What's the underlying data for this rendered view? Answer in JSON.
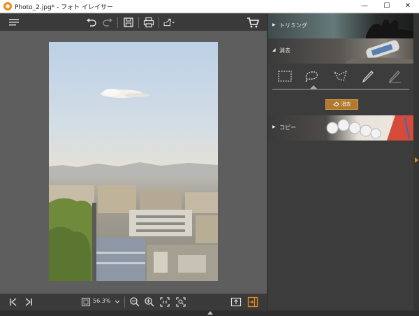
{
  "window": {
    "title": "Photo_2.jpg* - フォト イレイサー",
    "minimize_glyph": "—",
    "maximize_glyph": "☐",
    "close_glyph": "✕",
    "app_icon": "app-logo-icon"
  },
  "toolbar": {
    "icons": [
      "menu-icon",
      "undo-icon",
      "redo-icon",
      "save-icon",
      "print-icon",
      "share-icon",
      "cart-icon"
    ]
  },
  "canvas": {
    "image": "paris-rooftops-photo",
    "colors": {
      "background": "#5e5e5e",
      "sky_top": "#c5d7e6",
      "sky_bottom": "#e9e2d2"
    }
  },
  "bottombar": {
    "zoom_value": "56.3%",
    "icons": [
      "first-image-icon",
      "last-image-icon",
      "fit-screen-icon",
      "zoom-dropdown-icon",
      "zoom-out-icon",
      "zoom-in-icon",
      "actual-size-icon",
      "zoom-fit-icon",
      "export-icon",
      "toggle-panel-icon"
    ]
  },
  "panel": {
    "sections": [
      {
        "label": "トリミング",
        "expanded": false
      },
      {
        "label": "消去",
        "expanded": true
      },
      {
        "label": "コピー",
        "expanded": false
      }
    ],
    "erase_tools": [
      "rectangle-select-icon",
      "lasso-select-icon",
      "polygon-lasso-icon",
      "brush-icon",
      "eraser-brush-icon"
    ],
    "selected_tool": "lasso-select-icon",
    "erase_button_label": "消去",
    "accent_color": "#e88a1c"
  }
}
